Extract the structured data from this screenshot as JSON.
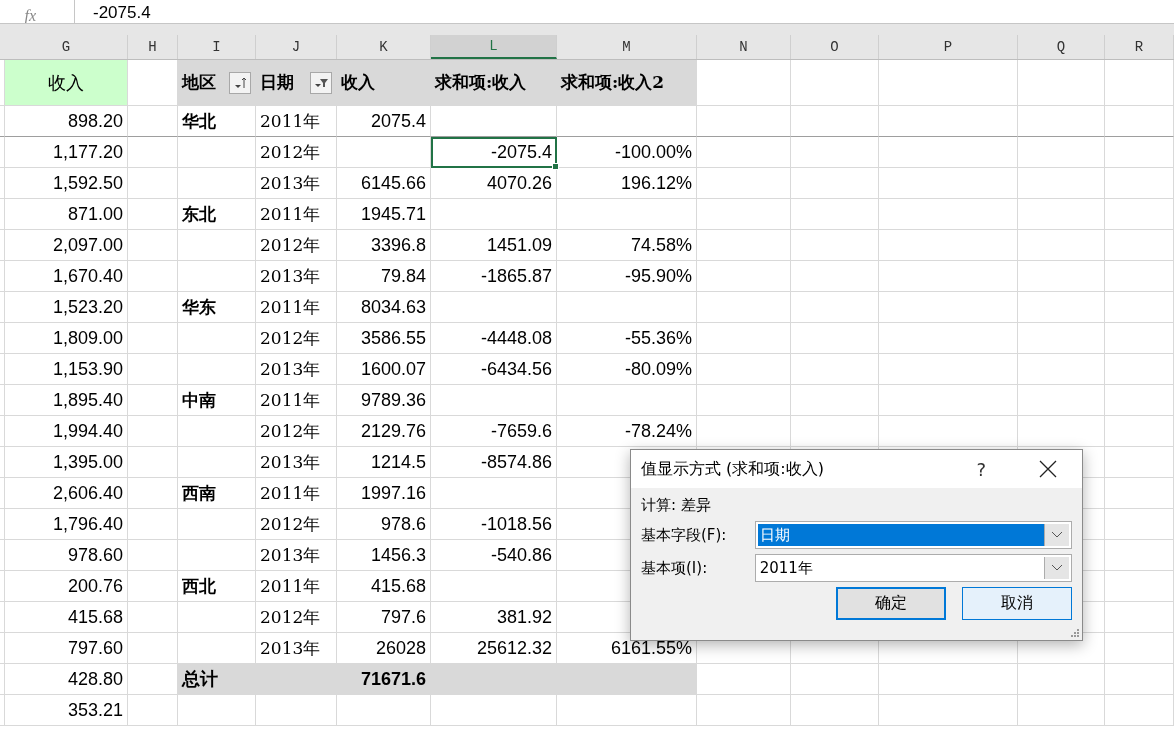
{
  "formula_bar": {
    "fx": "fx",
    "value": "-2075.4"
  },
  "columns": [
    {
      "label": "G",
      "selected": false
    },
    {
      "label": "H",
      "selected": false
    },
    {
      "label": "I",
      "selected": false
    },
    {
      "label": "J",
      "selected": false
    },
    {
      "label": "K",
      "selected": false
    },
    {
      "label": "L",
      "selected": true
    },
    {
      "label": "M",
      "selected": false
    },
    {
      "label": "N",
      "selected": false
    },
    {
      "label": "O",
      "selected": false
    },
    {
      "label": "P",
      "selected": false
    },
    {
      "label": "Q",
      "selected": false
    },
    {
      "label": "R",
      "selected": false
    }
  ],
  "header": {
    "g": "收入",
    "i": "地区",
    "j": "日期",
    "k": "收入",
    "l": "求和项:收入",
    "m": "求和项:收入2"
  },
  "rows": [
    {
      "kind": "data",
      "g": "898.20",
      "i": "华北",
      "j": "2011年",
      "k": "2075.4",
      "selected": false
    },
    {
      "kind": "data",
      "g": "1,177.20",
      "j": "2012年",
      "l": "-2075.4",
      "m": "-100.00%",
      "selected": true
    },
    {
      "kind": "data",
      "g": "1,592.50",
      "j": "2013年",
      "k": "6145.66",
      "l": "4070.26",
      "m": "196.12%",
      "selected": false
    },
    {
      "kind": "data",
      "g": "871.00",
      "i": "东北",
      "j": "2011年",
      "k": "1945.71",
      "selected": false
    },
    {
      "kind": "data",
      "g": "2,097.00",
      "j": "2012年",
      "k": "3396.8",
      "l": "1451.09",
      "m": "74.58%",
      "selected": false
    },
    {
      "kind": "data",
      "g": "1,670.40",
      "j": "2013年",
      "k": "79.84",
      "l": "-1865.87",
      "m": "-95.90%",
      "selected": false
    },
    {
      "kind": "data",
      "g": "1,523.20",
      "i": "华东",
      "j": "2011年",
      "k": "8034.63",
      "selected": false
    },
    {
      "kind": "data",
      "g": "1,809.00",
      "j": "2012年",
      "k": "3586.55",
      "l": "-4448.08",
      "m": "-55.36%",
      "selected": false
    },
    {
      "kind": "data",
      "g": "1,153.90",
      "j": "2013年",
      "k": "1600.07",
      "l": "-6434.56",
      "m": "-80.09%",
      "selected": false
    },
    {
      "kind": "data",
      "g": "1,895.40",
      "i": "中南",
      "j": "2011年",
      "k": "9789.36",
      "selected": false
    },
    {
      "kind": "data",
      "g": "1,994.40",
      "j": "2012年",
      "k": "2129.76",
      "l": "-7659.6",
      "m": "-78.24%",
      "selected": false
    },
    {
      "kind": "data",
      "g": "1,395.00",
      "j": "2013年",
      "k": "1214.5",
      "l": "-8574.86",
      "selected": false
    },
    {
      "kind": "data",
      "g": "2,606.40",
      "i": "西南",
      "j": "2011年",
      "k": "1997.16",
      "selected": false
    },
    {
      "kind": "data",
      "g": "1,796.40",
      "j": "2012年",
      "k": "978.6",
      "l": "-1018.56",
      "selected": false
    },
    {
      "kind": "data",
      "g": "978.60",
      "j": "2013年",
      "k": "1456.3",
      "l": "-540.86",
      "selected": false
    },
    {
      "kind": "data",
      "g": "200.76",
      "i": "西北",
      "j": "2011年",
      "k": "415.68",
      "selected": false
    },
    {
      "kind": "data",
      "g": "415.68",
      "j": "2012年",
      "k": "797.6",
      "l": "381.92",
      "selected": false
    },
    {
      "kind": "data",
      "g": "797.60",
      "j": "2013年",
      "k": "26028",
      "l": "25612.32",
      "m": "6161.55%",
      "selected": false
    },
    {
      "kind": "total",
      "g": "428.80",
      "i": "总计",
      "k": "71671.6",
      "selected": false
    },
    {
      "kind": "plain",
      "g": "353.21",
      "selected": false
    }
  ],
  "dialog": {
    "title": "值显示方式 (求和项:收入)",
    "help": "?",
    "calculation": "计算: 差异",
    "fields": [
      {
        "label": "基本字段(F):",
        "value": "日期",
        "selected": true
      },
      {
        "label": "基本项(I):",
        "value": "2011年",
        "selected": false
      }
    ],
    "buttons": [
      {
        "label": "确定",
        "kind": "default"
      },
      {
        "label": "取消",
        "kind": "focused"
      }
    ]
  }
}
